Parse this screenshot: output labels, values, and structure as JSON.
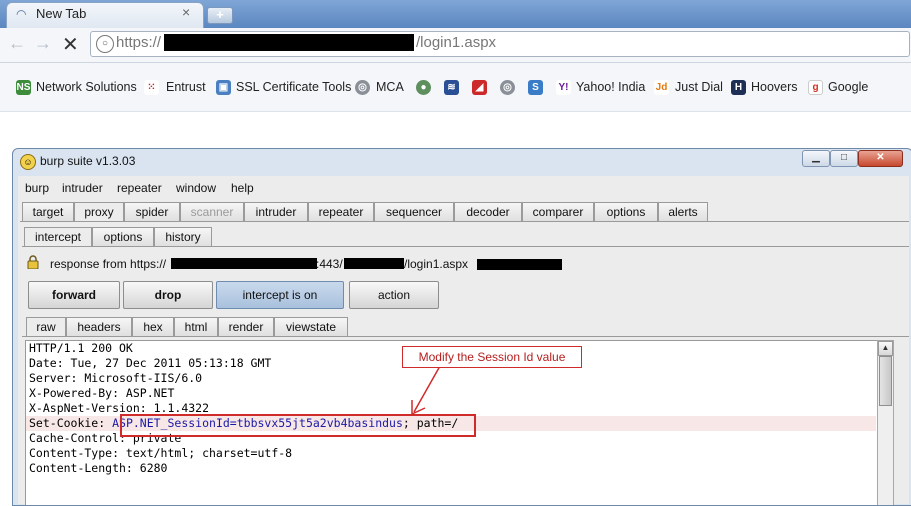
{
  "browser": {
    "tab_title": "New Tab",
    "tab_close": "×",
    "new_tab": "+",
    "back_icon": "back-arrow-icon",
    "forward_icon": "forward-arrow-icon",
    "stop_icon": "stop-x-icon",
    "url_scheme": "https://",
    "url_path": "/login1.aspx"
  },
  "bookmarks": [
    {
      "label": "Network Solutions",
      "icon": "ns-icon"
    },
    {
      "label": "Entrust",
      "icon": "entrust-icon"
    },
    {
      "label": "SSL Certificate Tools",
      "icon": "ssl-tools-icon"
    },
    {
      "label": "MCA",
      "icon": "mca-icon"
    },
    {
      "label": "Yahoo! India",
      "icon": "yahoo-icon"
    },
    {
      "label": "Just Dial",
      "icon": "justdial-icon"
    },
    {
      "label": "Hoovers",
      "icon": "hoovers-icon"
    },
    {
      "label": "Google",
      "icon": "google-icon"
    }
  ],
  "burp": {
    "window_title": "burp suite v1.3.03",
    "menu": [
      "burp",
      "intruder",
      "repeater",
      "window",
      "help"
    ],
    "main_tabs": [
      "target",
      "proxy",
      "spider",
      "scanner",
      "intruder",
      "repeater",
      "sequencer",
      "decoder",
      "comparer",
      "options",
      "alerts"
    ],
    "proxy_tabs": [
      "intercept",
      "options",
      "history"
    ],
    "response_label": "response from https://",
    "response_host_tail": ":443/",
    "response_page": "/login1.aspx",
    "buttons": {
      "forward": "forward",
      "drop": "drop",
      "intercept": "intercept is on",
      "action": "action"
    },
    "view_tabs": [
      "raw",
      "headers",
      "hex",
      "html",
      "render",
      "viewstate"
    ],
    "response_lines": [
      "HTTP/1.1 200 OK",
      "Date: Tue, 27 Dec 2011 05:13:18 GMT",
      "Server: Microsoft-IIS/6.0",
      "X-Powered-By: ASP.NET",
      "X-AspNet-Version: 1.1.4322",
      "Cache-Control: private",
      "Content-Type: text/html; charset=utf-8",
      "Content-Length: 6280"
    ],
    "cookie_line": {
      "prefix": "Set-Cookie: ",
      "value": "ASP.NET_SessionId=tbbsvx55jt5a2vb4basindus",
      "suffix": "; path=/"
    }
  },
  "annotation": {
    "callout": "Modify the Session Id value",
    "color": "#d02b2b"
  },
  "colors": {
    "tabstrip": "#5b86c0",
    "highlight_row": "#f8e7e7",
    "cookie_name": "#1a1aa6"
  }
}
